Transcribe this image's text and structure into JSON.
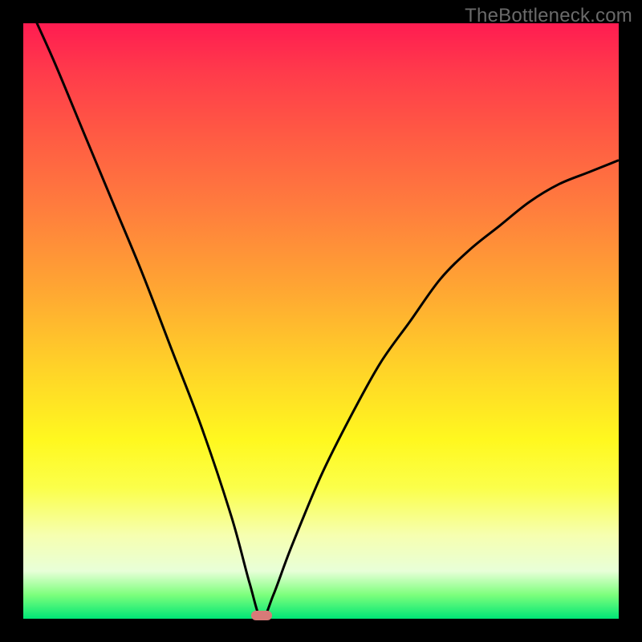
{
  "watermark": "TheBottleneck.com",
  "colors": {
    "frame": "#000000",
    "watermark_text": "#6a6a6a",
    "curve_stroke": "#000000",
    "marker_fill": "#d87a78",
    "gradient_stops": [
      "#ff1c51",
      "#ff3a4b",
      "#ff5844",
      "#ff7a3e",
      "#ffa433",
      "#ffd328",
      "#fff81f",
      "#fbff4a",
      "#f6ffb0",
      "#e8ffd8",
      "#7cff7c",
      "#00e676"
    ]
  },
  "chart_data": {
    "type": "line",
    "title": "",
    "xlabel": "",
    "ylabel": "",
    "xlim": [
      0,
      1
    ],
    "ylim": [
      0,
      1
    ],
    "note": "Axes are unlabeled in the image; values are normalized fractions of the plot area (0=left/bottom, 1=right/top). The curve is a single V-shaped line that descends from the upper-left to a minimum near x≈0.40 at y≈0, then rises toward the upper right.",
    "series": [
      {
        "name": "bottleneck-curve",
        "x": [
          0.0,
          0.05,
          0.1,
          0.15,
          0.2,
          0.25,
          0.3,
          0.35,
          0.38,
          0.4,
          0.42,
          0.45,
          0.5,
          0.55,
          0.6,
          0.65,
          0.7,
          0.75,
          0.8,
          0.85,
          0.9,
          0.95,
          1.0
        ],
        "y": [
          1.05,
          0.94,
          0.82,
          0.7,
          0.58,
          0.45,
          0.32,
          0.17,
          0.06,
          0.0,
          0.04,
          0.12,
          0.24,
          0.34,
          0.43,
          0.5,
          0.57,
          0.62,
          0.66,
          0.7,
          0.73,
          0.75,
          0.77
        ]
      }
    ],
    "marker": {
      "name": "minimum-marker",
      "x": 0.4,
      "y": 0.005,
      "color": "#d87a78"
    }
  }
}
